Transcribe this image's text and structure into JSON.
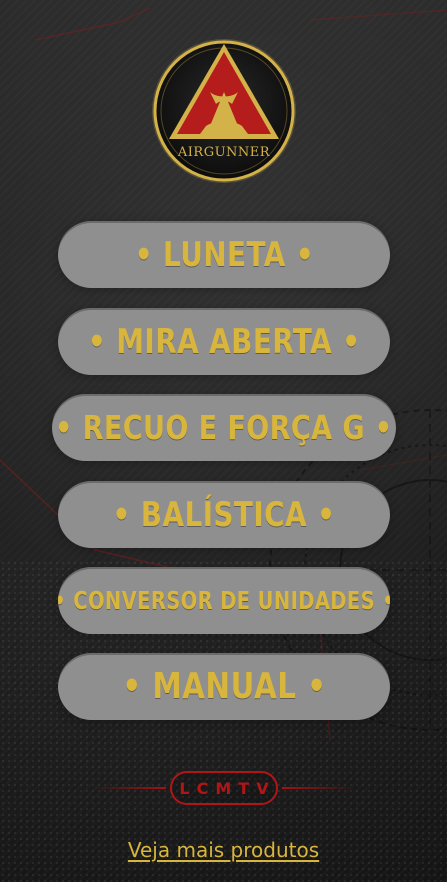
{
  "logo": {
    "text": "AIRGUNNER",
    "icon": "airgunner-emblem-icon"
  },
  "menu": {
    "items": [
      {
        "label": "• LUNETA •"
      },
      {
        "label": "• MIRA ABERTA •"
      },
      {
        "label": "• RECUO E FORÇA G •"
      },
      {
        "label": "• BALÍSTICA •"
      },
      {
        "label": "• CONVERSOR DE UNIDADES •"
      },
      {
        "label": "• MANUAL •"
      }
    ]
  },
  "brand": {
    "text": "LCMTV"
  },
  "footer": {
    "link_text": "Veja mais produtos"
  },
  "colors": {
    "button_bg": "#8f8f8f",
    "button_text": "#d8b53c",
    "brand_red": "#b11616",
    "background": "#1f1f1f"
  }
}
